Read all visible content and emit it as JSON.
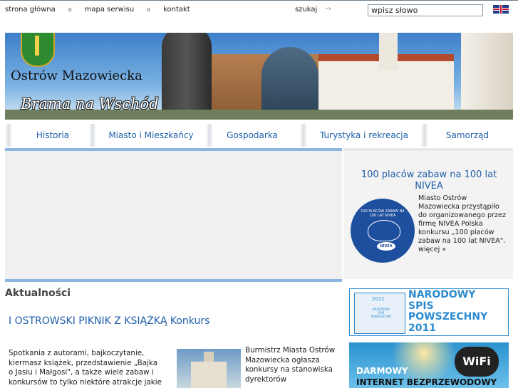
{
  "top_nav": {
    "links": [
      "strona główna",
      "mapa serwisu",
      "kontakt"
    ],
    "bullet": "o"
  },
  "search": {
    "label": "szukaj",
    "arrow": "-›",
    "value": "wpisz słowo"
  },
  "language": {
    "icon": "uk-flag-icon"
  },
  "banner": {
    "city": "Ostrów Mazowiecka",
    "slogan": "Brama na Wschód"
  },
  "main_nav": [
    "Historia",
    "Miasto i Mieszkańcy",
    "Gospodarka",
    "Turystyka i rekreacja",
    "Samorząd"
  ],
  "sidebar": {
    "featured_title": "100 placów zabaw na 100 lat NIVEA",
    "logo_caption": "100 PLACÓW ZABAW NA 100 LAT NIVEA",
    "logo_badge": "NIVEA",
    "featured_text": "Miasto Ostrów Mazowiecka przystąpiło do organizowanego przez firmę NIVEA Polska konkursu „100 placów zabaw na 100 lat NIVEA\".",
    "more_link": "więcej »",
    "spis_banner": {
      "year": "2011",
      "map_caption": "NARODOWY SPIS POWSZECHNY",
      "line1": "NARODOWY",
      "line2": "SPIS",
      "line3": "POWSZECHNY",
      "line4": "2011"
    },
    "wifi_banner": {
      "line1": "DARMOWY",
      "line2": "INTERNET BEZPRZEWODOWY",
      "logo": "WiFi"
    }
  },
  "news": {
    "section_title": "Aktualności",
    "headline": "I OSTROWSKI PIKNIK Z KSIĄŻKĄ Konkurs",
    "item1_text": "Spotkania z autorami, bajkoczytanie, kiermasz książek, przedstawienie „Bajka o Jasiu i Małgosi\", a także wiele zabaw i konkursów to tylko niektóre atrakcje jakie",
    "item2_text": "Burmistrz Miasta Ostrów Mazowiecka ogłasza konkursy na stanowiska dyrektorów"
  },
  "colors": {
    "link_blue": "#1f5fa8",
    "accent_line": "#8ab6e0",
    "spis_blue": "#2c8ad0"
  }
}
